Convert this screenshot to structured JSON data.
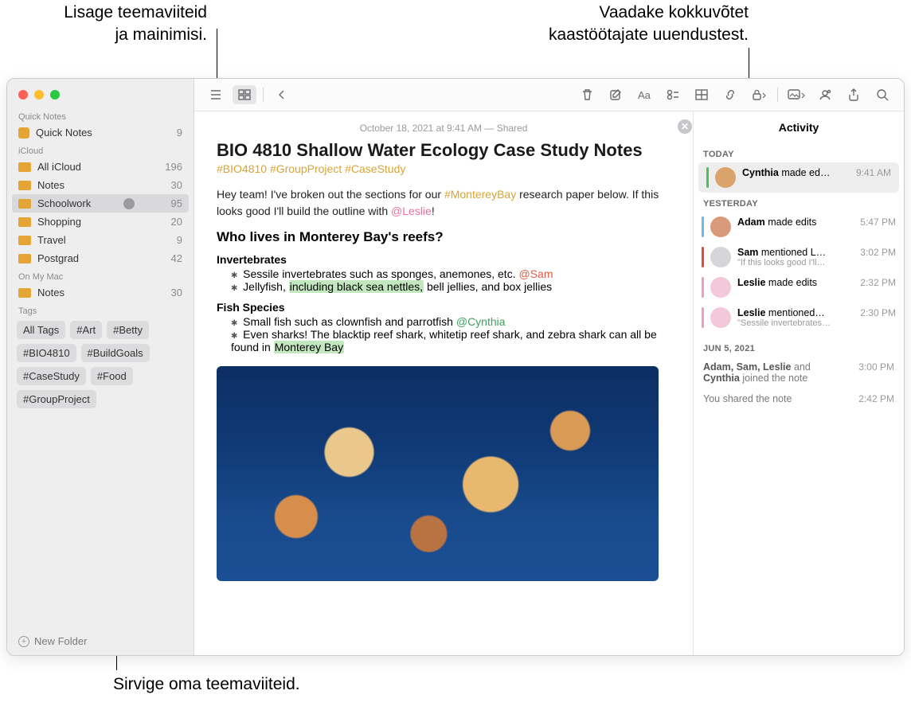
{
  "callouts": {
    "topLeft1": "Lisage teemaviiteid",
    "topLeft2": "ja mainimisi.",
    "topRight1": "Vaadake kokkuvõtet",
    "topRight2": "kaastöötajate uuendustest.",
    "bottom": "Sirvige oma teemaviiteid."
  },
  "sidebar": {
    "quickNotesHeader": "Quick Notes",
    "quickNotes": {
      "label": "Quick Notes",
      "count": "9"
    },
    "icloudHeader": "iCloud",
    "folders": [
      {
        "label": "All iCloud",
        "count": "196",
        "color": "#e4a536"
      },
      {
        "label": "Notes",
        "count": "30",
        "color": "#e4a536"
      },
      {
        "label": "Schoolwork",
        "count": "95",
        "color": "#e4a536",
        "selected": true,
        "shared": true
      },
      {
        "label": "Shopping",
        "count": "20",
        "color": "#e4a536"
      },
      {
        "label": "Travel",
        "count": "9",
        "color": "#e4a536"
      },
      {
        "label": "Postgrad",
        "count": "42",
        "color": "#e4a536"
      }
    ],
    "onMyMacHeader": "On My Mac",
    "localFolders": [
      {
        "label": "Notes",
        "count": "30",
        "color": "#e4a536"
      }
    ],
    "tagsHeader": "Tags",
    "tags": [
      "All Tags",
      "#Art",
      "#Betty",
      "#BIO4810",
      "#BuildGoals",
      "#CaseStudy",
      "#Food",
      "#GroupProject"
    ],
    "newFolder": "New Folder"
  },
  "note": {
    "date": "October 18, 2021 at 9:41 AM — Shared",
    "title": "BIO 4810 Shallow Water Ecology Case Study Notes",
    "tags": "#BIO4810 #GroupProject #CaseStudy",
    "p1a": "Hey team! I've broken out the sections for our ",
    "p1tag": "#MontereyBay",
    "p1b": " research paper below. If this looks good I'll build the outline with ",
    "p1mention": "@Leslie",
    "p1c": "!",
    "h2": "Who lives in Monterey Bay's reefs?",
    "h3a": "Invertebrates",
    "bul1a": "Sessile invertebrates such as sponges, anemones, etc. ",
    "bul1mention": "@Sam",
    "bul2a": "Jellyfish, ",
    "bul2hl": "including black sea nettles,",
    "bul2b": " bell jellies, and box jellies",
    "h3b": "Fish Species",
    "bul3a": "Small fish such as clownfish and parrotfish ",
    "bul3mention": "@Cynthia",
    "bul4a": "Even sharks! The blacktip reef shark, whitetip reef shark, and zebra shark can all be found in ",
    "bul4hl": "Monterey Bay"
  },
  "activity": {
    "title": "Activity",
    "today": "TODAY",
    "yesterday": "YESTERDAY",
    "olderDate": "JUN 5, 2021",
    "items": [
      {
        "color": "#4cc05b",
        "avatar": "#d9a36b",
        "main": "<b>Cynthia</b> made ed…",
        "time": "9:41 AM"
      },
      {
        "color": "#6fb8e8",
        "avatar": "#d89a7a",
        "main": "<b>Adam</b> made edits",
        "time": "5:47 PM"
      },
      {
        "color": "#e34a3d",
        "avatar": "#d6d6d8",
        "main": "<b>Sam</b> mentioned L…",
        "sub": "\"If this looks good I'll…",
        "time": "3:02 PM"
      },
      {
        "color": "#f29bc4",
        "avatar": "#f2c8da",
        "main": "<b>Leslie</b> made edits",
        "time": "2:32 PM"
      },
      {
        "color": "#f29bc4",
        "avatar": "#f2c8da",
        "main": "<b>Leslie</b> mentioned…",
        "sub": "\"Sessile invertebrates…",
        "time": "2:30 PM"
      }
    ],
    "plain": [
      {
        "main": "<b>Adam, Sam, Leslie</b> and <b>Cynthia</b> joined the note",
        "time": "3:00 PM"
      },
      {
        "main": "You shared the note",
        "time": "2:42 PM"
      }
    ]
  }
}
